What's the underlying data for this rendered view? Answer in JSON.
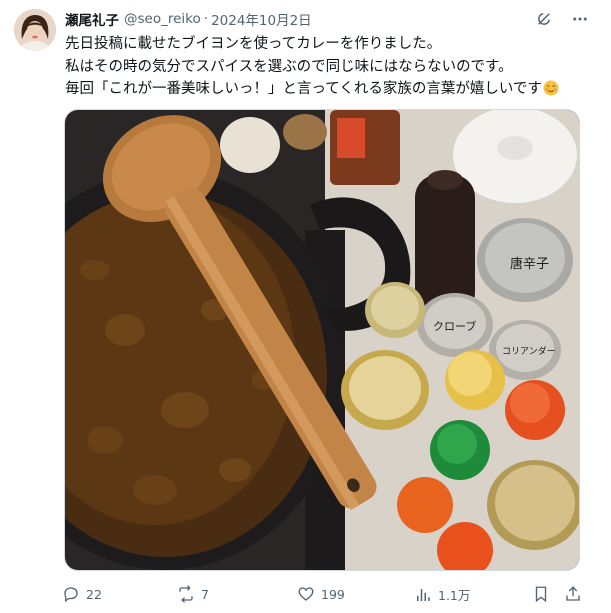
{
  "post": {
    "author": {
      "display_name": "瀬尾礼子",
      "handle": "@seo_reiko",
      "separator": "·",
      "date": "2024年10月2日"
    },
    "text_lines": [
      "先日投稿に載せたブイヨンを使ってカレーを作りました。",
      "私はその時の気分でスパイスを選ぶので同じ味にはならないのです。",
      "毎回「これが一番美味しいっ！」と言ってくれる家族の言葉が嬉しいです"
    ],
    "emoji": "blush-emoji",
    "photo": {
      "can_labels": [
        "唐辛子",
        "クローブ",
        "コリアンダー"
      ],
      "package_text": "スパイス"
    },
    "actions": {
      "reply_count": "22",
      "repost_count": "7",
      "like_count": "199",
      "view_count": "1.1万"
    },
    "icons": {
      "top": [
        "grok-icon",
        "more-icon"
      ],
      "actions": [
        "reply-icon",
        "repost-icon",
        "like-icon",
        "views-icon",
        "bookmark-icon",
        "share-icon"
      ]
    },
    "colors": {
      "text_primary": "#0f1419",
      "text_secondary": "#536471",
      "border": "#cfd9de"
    }
  }
}
